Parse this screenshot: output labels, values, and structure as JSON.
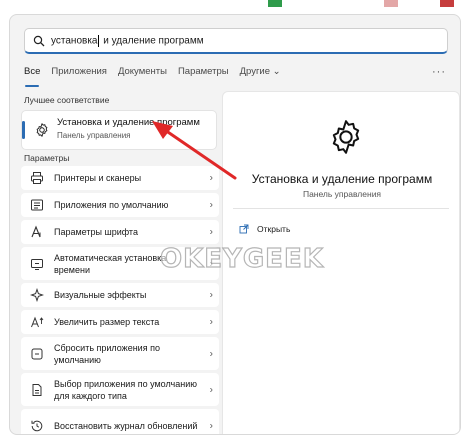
{
  "search": {
    "typed": "установка",
    "rest": " и удаление программ"
  },
  "tabs": [
    {
      "label": "Все"
    },
    {
      "label": "Приложения"
    },
    {
      "label": "Документы"
    },
    {
      "label": "Параметры"
    },
    {
      "label": "Другие ⌄"
    }
  ],
  "more": "···",
  "best_match": {
    "section": "Лучшее соответствие",
    "title": "Установка и удаление программ",
    "subtitle": "Панель управления",
    "icon": "gear-icon"
  },
  "settings": {
    "section": "Параметры",
    "items": [
      {
        "label": "Принтеры и сканеры",
        "icon": "printer-icon"
      },
      {
        "label": "Приложения по умолчанию",
        "icon": "default-apps-icon"
      },
      {
        "label": "Параметры шрифта",
        "icon": "font-icon"
      },
      {
        "label": "Автоматическая установка времени",
        "icon": "clock-icon"
      },
      {
        "label": "Визуальные эффекты",
        "icon": "effects-icon"
      },
      {
        "label": "Увеличить размер текста",
        "icon": "text-size-icon"
      },
      {
        "label": "Сбросить приложения по умолчанию",
        "icon": "reset-icon"
      },
      {
        "label": "Выбор приложения по умолчанию для каждого типа",
        "icon": "file-type-icon"
      },
      {
        "label": "Восстановить журнал обновлений",
        "icon": "history-icon"
      }
    ]
  },
  "detail": {
    "title": "Установка и удаление программ",
    "subtitle": "Панель управления",
    "open_label": "Открыть"
  },
  "watermark": "OKEYGEEK",
  "colors": {
    "accent": "#2b6cb3",
    "arrow": "#e02828"
  }
}
